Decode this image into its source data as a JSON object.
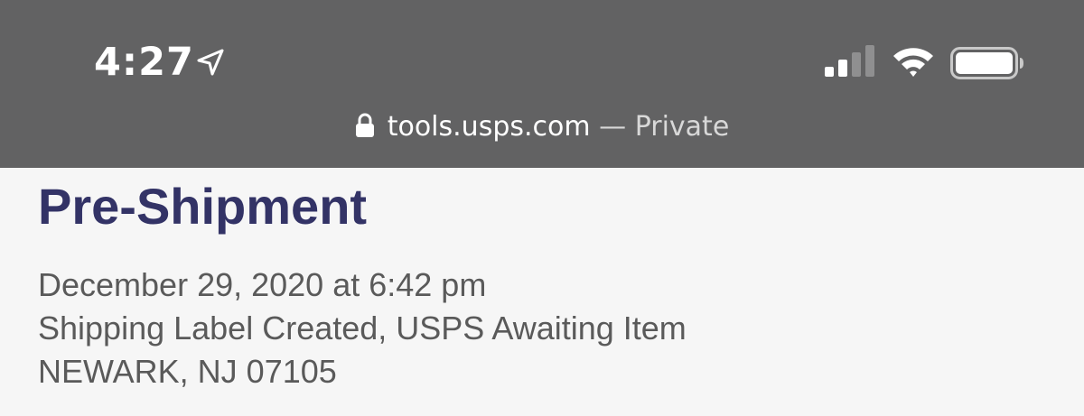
{
  "status_bar": {
    "time": "4:27",
    "location_icon": "location-arrow-icon",
    "signal_icon": "cellular-signal-icon",
    "wifi_icon": "wifi-icon",
    "battery_icon": "battery-icon",
    "signal_bars_active": 2,
    "signal_bars_total": 4
  },
  "browser": {
    "lock_icon": "lock-icon",
    "host": "tools.usps.com",
    "separator": " — ",
    "mode": "Private"
  },
  "tracking": {
    "status_title": "Pre-Shipment",
    "datetime": "December 29, 2020 at 6:42 pm",
    "event": "Shipping Label Created, USPS Awaiting Item",
    "location": "NEWARK, NJ 07105"
  },
  "colors": {
    "topbar_bg": "#626263",
    "page_bg": "#f6f6f6",
    "title": "#333366",
    "detail_text": "#5a5a5a"
  }
}
